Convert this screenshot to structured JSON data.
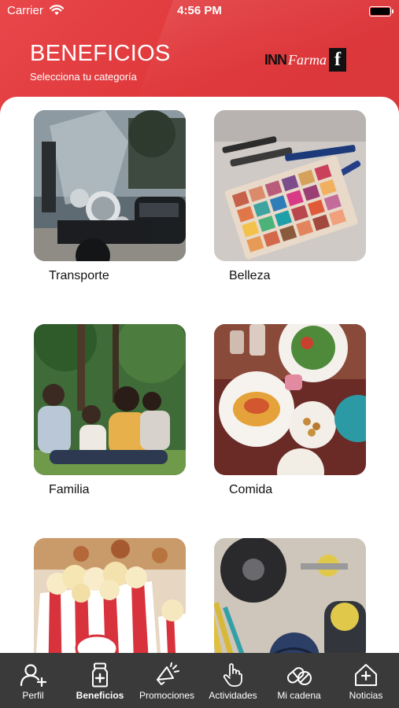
{
  "status_bar": {
    "carrier": "Carrier",
    "time": "4:56 PM"
  },
  "header": {
    "title": "BENEFICIOS",
    "subtitle": "Selecciona tu categoría"
  },
  "logo": {
    "inn": "INN",
    "farma": "Farma",
    "mark": "f"
  },
  "categories": [
    {
      "label": "Transporte",
      "image": "motorcycle"
    },
    {
      "label": "Belleza",
      "image": "makeup-palette"
    },
    {
      "label": "Familia",
      "image": "family"
    },
    {
      "label": "Comida",
      "image": "food-table"
    },
    {
      "label": "",
      "image": "popcorn"
    },
    {
      "label": "",
      "image": "gym-equipment"
    }
  ],
  "tabs": [
    {
      "label": "Perfil",
      "icon": "add-user-icon",
      "active": false
    },
    {
      "label": "Beneficios",
      "icon": "medicine-bottle-icon",
      "active": true
    },
    {
      "label": "Promociones",
      "icon": "megaphone-icon",
      "active": false
    },
    {
      "label": "Actividades",
      "icon": "hand-pointer-icon",
      "active": false
    },
    {
      "label": "Mi cadena",
      "icon": "pills-icon",
      "active": false
    },
    {
      "label": "Noticias",
      "icon": "news-house-icon",
      "active": false
    }
  ],
  "colors": {
    "header_red": "#e0393c",
    "tabbar": "#3a3a3a"
  }
}
